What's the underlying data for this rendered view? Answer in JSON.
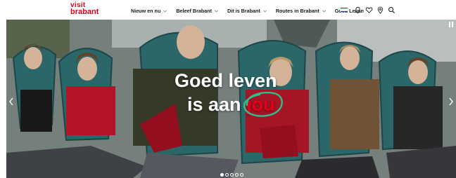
{
  "brand": {
    "line1": "visit",
    "line2": "brabant",
    "color": "#e3001b"
  },
  "nav": {
    "items": [
      {
        "label": "Nieuw en nu",
        "has_dropdown": true
      },
      {
        "label": "Beleef Brabant",
        "has_dropdown": true
      },
      {
        "label": "Dit is Brabant",
        "has_dropdown": true
      },
      {
        "label": "Routes in Brabant",
        "has_dropdown": true
      },
      {
        "label": "Goed Leven",
        "has_dropdown": false
      }
    ],
    "utility_icons": [
      "netherlands-flag-icon",
      "bell-icon",
      "heart-icon",
      "location-pin-icon",
      "search-icon"
    ]
  },
  "hero": {
    "headline_line1": "Goed leven",
    "headline_line2": "is aan",
    "headline_highlight": "jou",
    "highlight_circle_color": "#2fbf8a",
    "carousel": {
      "total_slides": 5,
      "active_index": 0
    },
    "controls": [
      "chevron-left-icon",
      "chevron-right-icon",
      "pause-icon"
    ]
  }
}
